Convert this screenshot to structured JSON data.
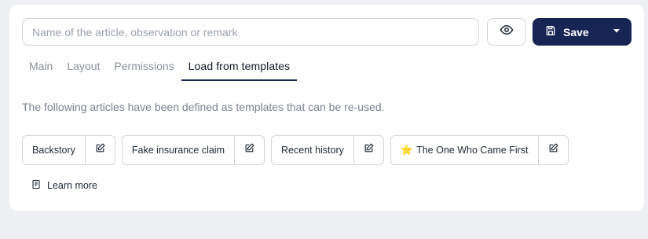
{
  "editor": {
    "name_placeholder": "Name of the article, observation or remark",
    "name_value": ""
  },
  "toolbar": {
    "preview_icon": "eye-icon",
    "save_label": "Save",
    "save_icon": "floppy-disk-icon",
    "save_menu_icon": "chevron-down-icon",
    "accent_color": "#172554"
  },
  "tabs": [
    {
      "label": "Main",
      "active": false
    },
    {
      "label": "Layout",
      "active": false
    },
    {
      "label": "Permissions",
      "active": false
    },
    {
      "label": "Load from templates",
      "active": true
    }
  ],
  "templates_section": {
    "description": "The following articles have been defined as templates that can be re-used.",
    "items": [
      {
        "label": "Backstory",
        "starred": false
      },
      {
        "label": "Fake insurance claim",
        "starred": false
      },
      {
        "label": "Recent history",
        "starred": false
      },
      {
        "label": "The One Who Came First",
        "starred": true,
        "star_glyph": "⭐"
      }
    ],
    "edit_icon": "edit-icon",
    "learn_more_label": "Learn more",
    "learn_more_icon": "book-icon"
  }
}
